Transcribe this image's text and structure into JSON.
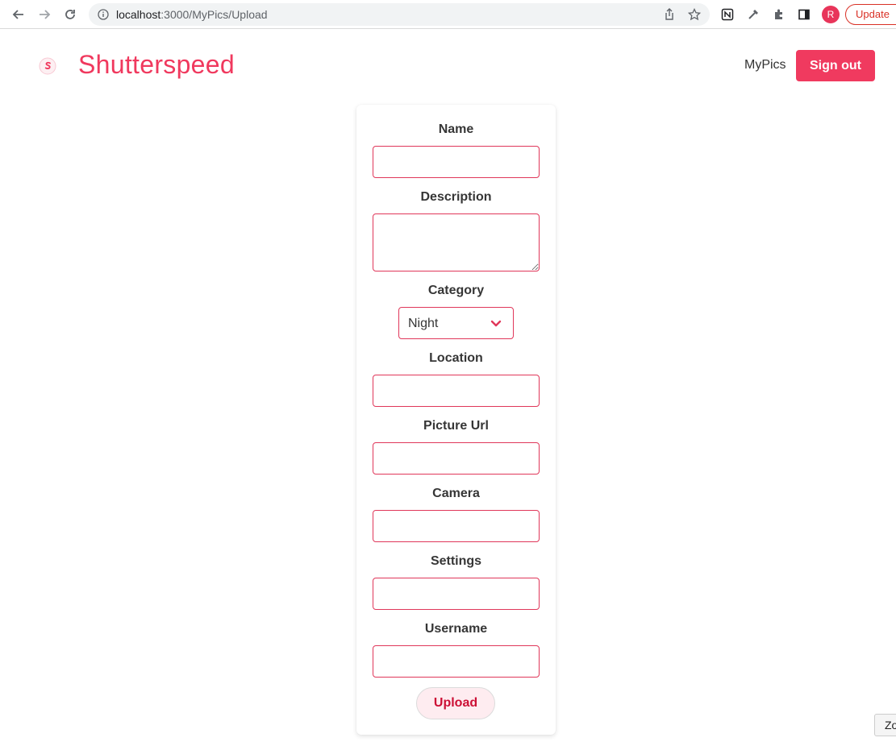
{
  "browser": {
    "url_host": "localhost",
    "url_rest": ":3000/MyPics/Upload",
    "profile_initial": "R",
    "update_label": "Update"
  },
  "header": {
    "title": "Shutterspeed",
    "nav_mypics": "MyPics",
    "signout_label": "Sign out"
  },
  "form": {
    "name_label": "Name",
    "description_label": "Description",
    "category_label": "Category",
    "category_value": "Night",
    "location_label": "Location",
    "picture_url_label": "Picture Url",
    "camera_label": "Camera",
    "settings_label": "Settings",
    "username_label": "Username",
    "upload_label": "Upload"
  },
  "zoom_hint": "Zo",
  "colors": {
    "brand": "#f0395e",
    "input_border": "#e0375a",
    "upload_bg": "#feecf0",
    "upload_text": "#cc0f35"
  }
}
